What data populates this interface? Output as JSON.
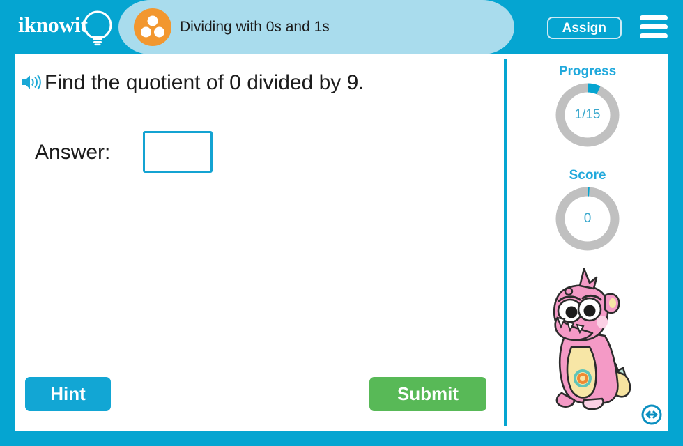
{
  "header": {
    "logo_text": "iknowit",
    "logo_icon": "lightbulb-icon",
    "topic_icon": "three-dots-circle-icon",
    "topic_title": "Dividing with 0s and 1s",
    "assign_label": "Assign",
    "menu_icon": "hamburger-menu-icon",
    "bar_color": "#05a5d1",
    "tab_color": "#a9dced",
    "topic_icon_color": "#f2972f"
  },
  "question": {
    "speaker_icon": "speaker-audio-icon",
    "text": "Find the quotient of 0 divided by 9."
  },
  "answer": {
    "label": "Answer:",
    "value": "",
    "placeholder": ""
  },
  "actions": {
    "hint_label": "Hint",
    "hint_color": "#12a6d4",
    "submit_label": "Submit",
    "submit_color": "#58b957"
  },
  "sidebar": {
    "progress": {
      "label": "Progress",
      "value": "1/15",
      "current": 1,
      "total": 15,
      "arc_color": "#05a5d1",
      "track_color": "#c0c0c0"
    },
    "score": {
      "label": "Score",
      "value": "0",
      "current": 0,
      "total": 15,
      "arc_color": "#05a5d1",
      "track_color": "#c0c0c0"
    },
    "mascot_icon": "pink-monster-mascot",
    "resize_icon": "resize-horizontal-icon"
  },
  "theme": {
    "frame_color": "#05a5d1",
    "panel_color": "#ffffff",
    "divider_color": "#05a5d1",
    "accent_blue": "#21a9dc",
    "text_color": "#1c1c1c"
  }
}
